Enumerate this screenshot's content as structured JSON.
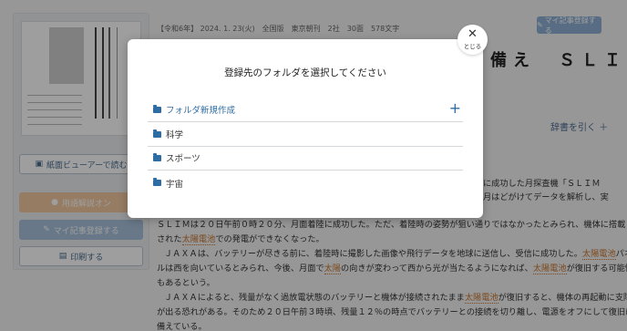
{
  "sidebar": {
    "viewer_label": "紙面ビューアーで読む",
    "comment_label": "用語解説オン",
    "mykiji_label": "マイ記事登録する",
    "print_label": "印刷する"
  },
  "article": {
    "meta": "【令和6年】 2024. 1. 23(火)　全国版　東京朝刊　2社　30面　578文字",
    "register_label": "マイ記事登録する",
    "title_fragment": "備え　ＳＬＩＭ",
    "jisho_label": "辞書を引く ＋",
    "line1": "に成功した月探査機「ＳＬＩＭ",
    "line2": "月はどがけてデータを解析し、実",
    "line3": "ＳＬＩＭは２０日午前０時２０分、月面着陸に成功した。ただ、着陸時の姿勢が狙い通りではなかったとみられ、機体に搭載",
    "line4a": "された",
    "taiyo": "太陽電池",
    "line4b": "での発電ができなくなった。",
    "line5a": "ＪＡＸＡは、バッテリーが尽きる前に、着陸時に撮影した画像や飛行データを地球に送信し、受信に成功した。",
    "line5b": "パネ",
    "line6a": "ルは西を向いているとみられ、今後、月面で",
    "taiyo_short": "太陽",
    "line6b": "の向きが変わって西から光が当たるようになれば、",
    "line6c": "が復旧する可能性",
    "line7": "もあるという。",
    "line8a": "ＪＡＸＡによると、残量がなく過放電状態のバッテリーと機体が接続されたまま",
    "line8b": "が復旧すると、機体の再起動に支障",
    "line9": "が出る恐れがある。そのため２０日午前３時頃、残量１２％の時点でバッテリーとの接続を切り離し、電源をオフにして復旧に",
    "line10": "備えている。"
  },
  "modal": {
    "title": "登録先のフォルダを選択してください",
    "close_label": "とじる",
    "new_folder_label": "フォルダ新規作成",
    "folders": [
      "科学",
      "スポーツ",
      "宇宙"
    ]
  }
}
